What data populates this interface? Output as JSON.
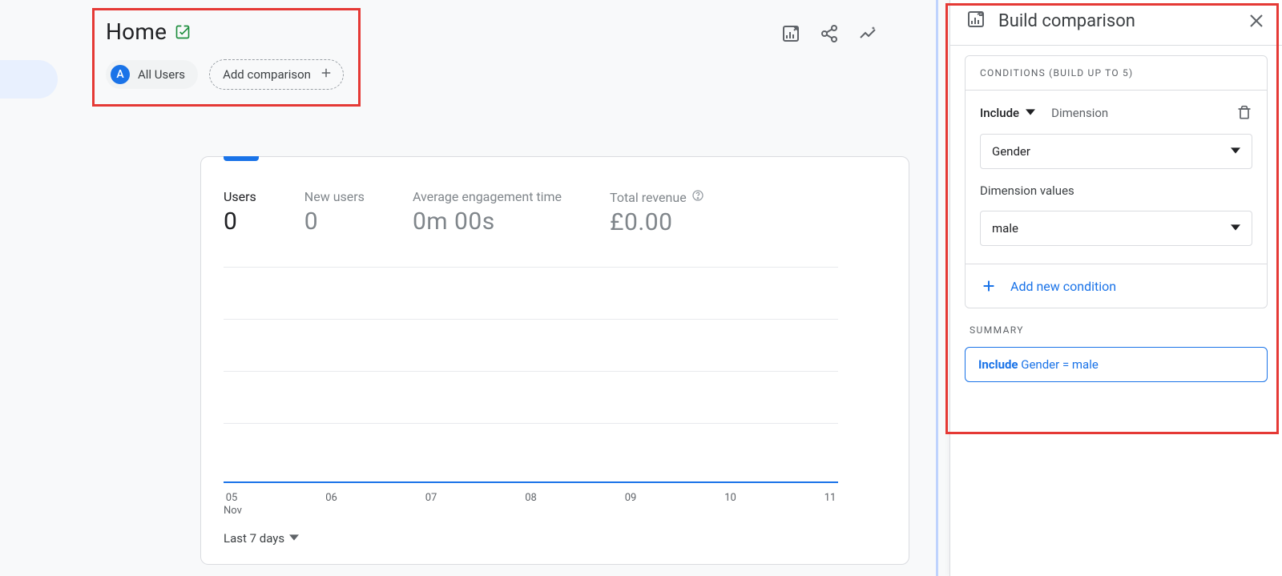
{
  "page": {
    "title": "Home"
  },
  "chips": {
    "badge_letter": "A",
    "all_label": "All Users",
    "add_label": "Add comparison"
  },
  "metrics": [
    {
      "label": "Users",
      "value": "0",
      "active": true
    },
    {
      "label": "New users",
      "value": "0",
      "active": false
    },
    {
      "label": "Average engagement time",
      "value": "0m 00s",
      "active": false
    },
    {
      "label": "Total revenue",
      "value": "£0.00",
      "active": false,
      "help": true
    }
  ],
  "chart_data": {
    "type": "line",
    "title": "",
    "xlabel": "",
    "ylabel": "",
    "categories": [
      "05",
      "06",
      "07",
      "08",
      "09",
      "10",
      "11"
    ],
    "month_label": "Nov",
    "series": [
      {
        "name": "Users",
        "values": [
          0,
          0,
          0,
          0,
          0,
          0,
          0
        ]
      }
    ],
    "ylim": [
      0,
      1
    ],
    "gridlines": 4
  },
  "date_picker": {
    "label": "Last 7 days"
  },
  "panel": {
    "title": "Build comparison",
    "conditions_header": "CONDITIONS (BUILD UP TO 5)",
    "include_label": "Include",
    "dimension_label": "Dimension",
    "dimension_value": "Gender",
    "values_label": "Dimension values",
    "values_value": "male",
    "add_condition": "Add new condition",
    "summary_header": "SUMMARY",
    "summary_prefix": "Include",
    "summary_text": "Gender = male"
  }
}
